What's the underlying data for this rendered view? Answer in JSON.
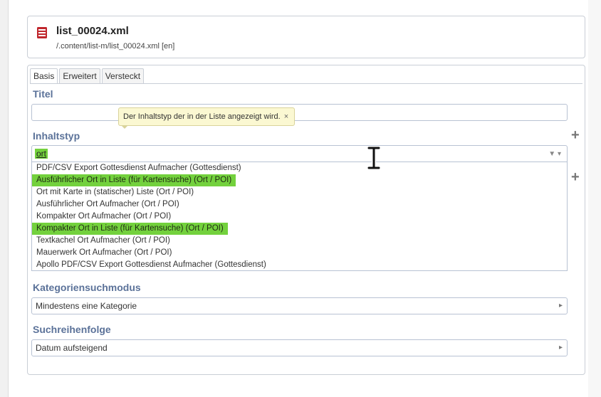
{
  "header": {
    "title": "list_00024.xml",
    "path": "/.content/list-m/list_00024.xml [en]",
    "icon": "file-icon"
  },
  "tabs": [
    {
      "label": "Basis",
      "active": true
    },
    {
      "label": "Erweitert",
      "active": false
    },
    {
      "label": "Versteckt",
      "active": false
    }
  ],
  "fields": {
    "titel": {
      "label": "Titel",
      "value": ""
    },
    "tooltip": {
      "text": "Der Inhaltstyp der in der Liste angezeigt wird.",
      "close": "×"
    },
    "inhaltstyp": {
      "label": "Inhaltstyp",
      "filter_value": "ort",
      "filter_icon": "▼ ▾",
      "options": [
        {
          "label": "PDF/CSV Export Gottesdienst Aufmacher (Gottesdienst)",
          "highlighted": false
        },
        {
          "label": "Ausführlicher Ort in Liste (für Kartensuche) (Ort / POI)",
          "highlighted": true
        },
        {
          "label": "Ort mit Karte in (statischer) Liste (Ort / POI)",
          "highlighted": false
        },
        {
          "label": "Ausführlicher Ort Aufmacher (Ort / POI)",
          "highlighted": false
        },
        {
          "label": "Kompakter Ort Aufmacher (Ort / POI)",
          "highlighted": false
        },
        {
          "label": "Kompakter Ort in Liste (für Kartensuche) (Ort / POI)",
          "highlighted": true
        },
        {
          "label": "Textkachel Ort Aufmacher (Ort / POI)",
          "highlighted": false
        },
        {
          "label": "Mauerwerk Ort Aufmacher (Ort / POI)",
          "highlighted": false
        },
        {
          "label": "Apollo PDF/CSV Export Gottesdienst Aufmacher (Gottesdienst)",
          "highlighted": false
        }
      ]
    },
    "kategoriensuchmodus": {
      "label": "Kategoriensuchmodus",
      "value": "Mindestens eine Kategorie"
    },
    "suchreihenfolge": {
      "label": "Suchreihenfolge",
      "value": "Datum aufsteigend"
    }
  },
  "buttons": {
    "plus": "+"
  },
  "colors": {
    "label": "#5b7299",
    "highlight": "#73d13d",
    "tooltip_bg": "#fbf8d2",
    "icon_red": "#c0272d"
  }
}
